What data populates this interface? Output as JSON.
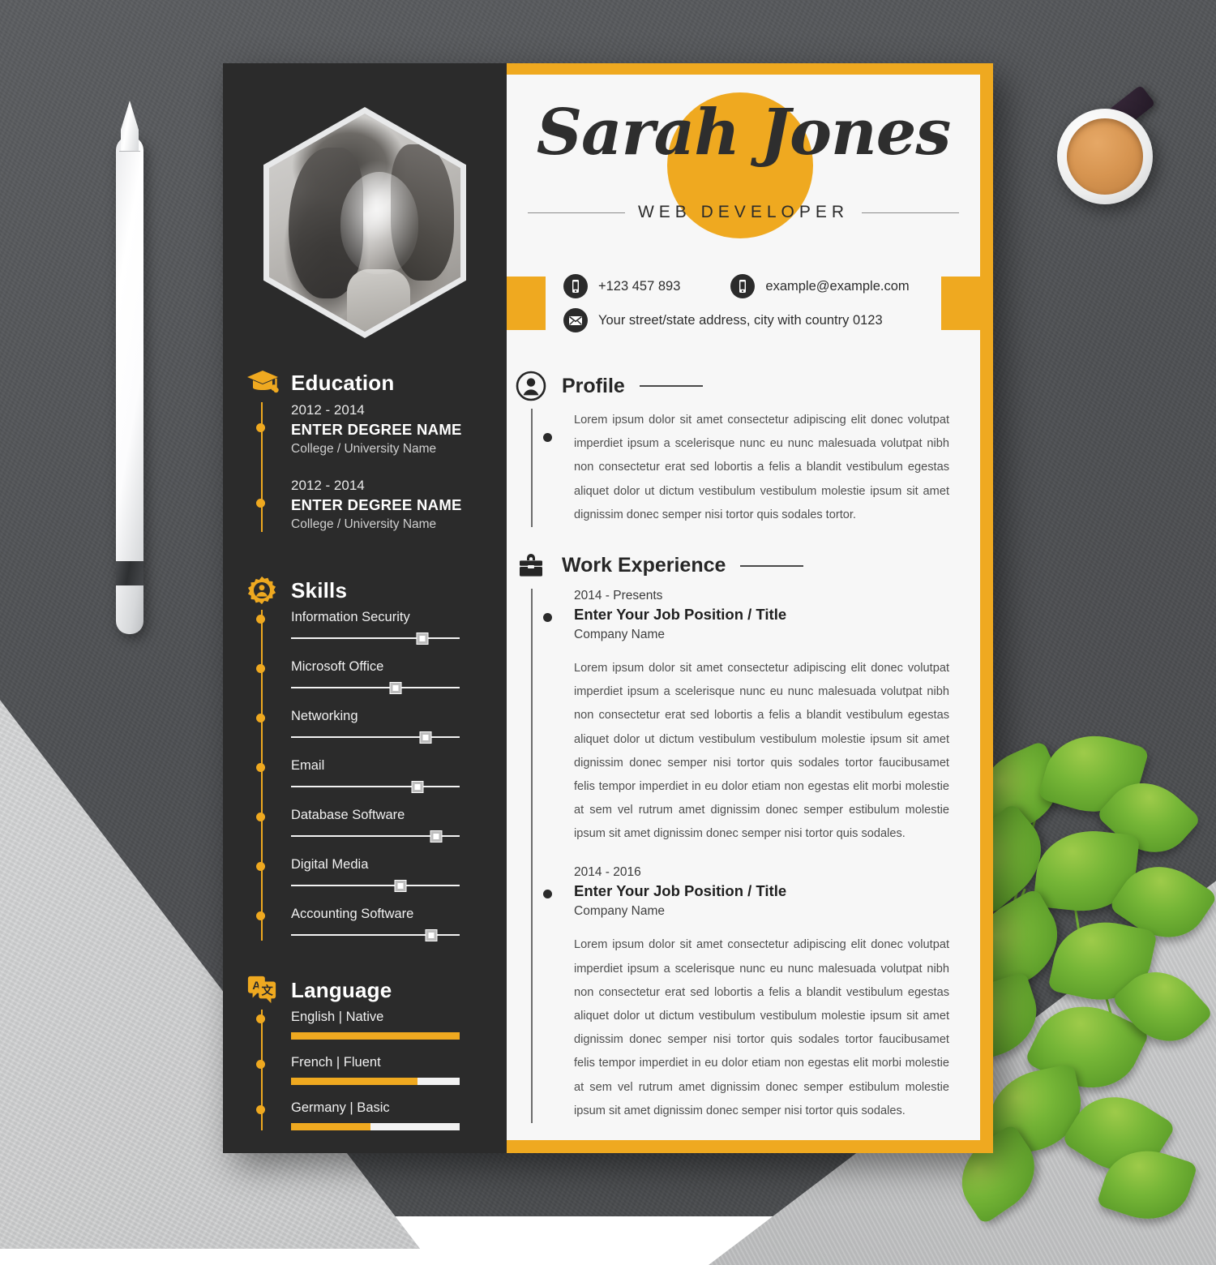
{
  "scene": {
    "stylus": "white-stylus-pen",
    "coffee": "coffee-cup",
    "plant": "pothos-plant"
  },
  "resume": {
    "photo_alt": "portrait-photo",
    "header": {
      "name": "Sarah Jones",
      "job_title": "WEB DEVELOPER"
    },
    "contact": {
      "phone": "+123 457 893",
      "email": "example@example.com",
      "address": "Your street/state address, city with country 0123",
      "phone_icon": "mobile-phone-icon",
      "email_icon": "mobile-phone-icon",
      "address_icon": "envelope-icon"
    },
    "sidebar": {
      "education": {
        "title": "Education",
        "icon": "graduation-cap-icon",
        "items": [
          {
            "years": "2012 - 2014",
            "degree": "ENTER DEGREE NAME",
            "school": "College / University Name"
          },
          {
            "years": "2012 - 2014",
            "degree": "ENTER DEGREE NAME",
            "school": "College / University Name"
          }
        ]
      },
      "skills": {
        "title": "Skills",
        "icon": "gear-person-icon",
        "items": [
          {
            "name": "Information Security",
            "level": 78
          },
          {
            "name": "Microsoft Office",
            "level": 62
          },
          {
            "name": "Networking",
            "level": 80
          },
          {
            "name": "Email",
            "level": 75
          },
          {
            "name": "Database Software",
            "level": 86
          },
          {
            "name": "Digital Media",
            "level": 65
          },
          {
            "name": "Accounting Software",
            "level": 83
          }
        ]
      },
      "language": {
        "title": "Language",
        "icon": "translate-icon",
        "items": [
          {
            "name": "English | Native",
            "level": 100
          },
          {
            "name": "French | Fluent",
            "level": 75
          },
          {
            "name": "Germany | Basic",
            "level": 47
          }
        ]
      }
    },
    "main": {
      "profile": {
        "title": "Profile",
        "icon": "user-circle-icon",
        "text": "Lorem ipsum dolor sit amet consectetur adipiscing elit donec volutpat imperdiet ipsum a scelerisque nunc eu nunc malesuada volutpat nibh non consectetur erat sed lobortis a felis a blandit vestibulum egestas aliquet dolor ut dictum vestibulum vestibulum molestie ipsum sit amet dignissim donec semper nisi tortor quis sodales tortor."
      },
      "work": {
        "title": "Work Experience",
        "icon": "briefcase-icon",
        "items": [
          {
            "years": "2014 - Presents",
            "title": "Enter Your Job Position / Title",
            "company": "Company Name",
            "text": "Lorem ipsum dolor sit amet consectetur adipiscing elit donec volutpat imperdiet ipsum a scelerisque nunc eu nunc malesuada volutpat nibh non consectetur erat sed lobortis a felis a blandit vestibulum egestas aliquet dolor ut dictum vestibulum vestibulum molestie ipsum sit amet dignissim donec semper nisi tortor quis sodales tortor faucibusamet felis tempor imperdiet in eu dolor etiam non egestas elit morbi molestie at sem vel rutrum amet dignissim donec semper estibulum molestie ipsum sit amet dignissim donec semper nisi tortor quis sodales."
          },
          {
            "years": "2014 - 2016",
            "title": "Enter Your Job Position / Title",
            "company": "Company Name",
            "text": "Lorem ipsum dolor sit amet consectetur adipiscing elit donec volutpat imperdiet ipsum a scelerisque nunc eu nunc malesuada volutpat nibh non consectetur erat sed lobortis a felis a blandit vestibulum egestas aliquet dolor ut dictum vestibulum vestibulum molestie ipsum sit amet dignissim donec semper nisi tortor quis sodales tortor faucibusamet felis tempor imperdiet in eu dolor etiam non egestas elit morbi molestie at sem vel rutrum amet dignissim donec semper estibulum molestie ipsum sit amet dignissim donec semper nisi tortor quis sodales."
          }
        ]
      }
    },
    "colors": {
      "accent": "#efa920",
      "sidebar": "#2b2b2b",
      "paper": "#f7f7f7"
    }
  }
}
